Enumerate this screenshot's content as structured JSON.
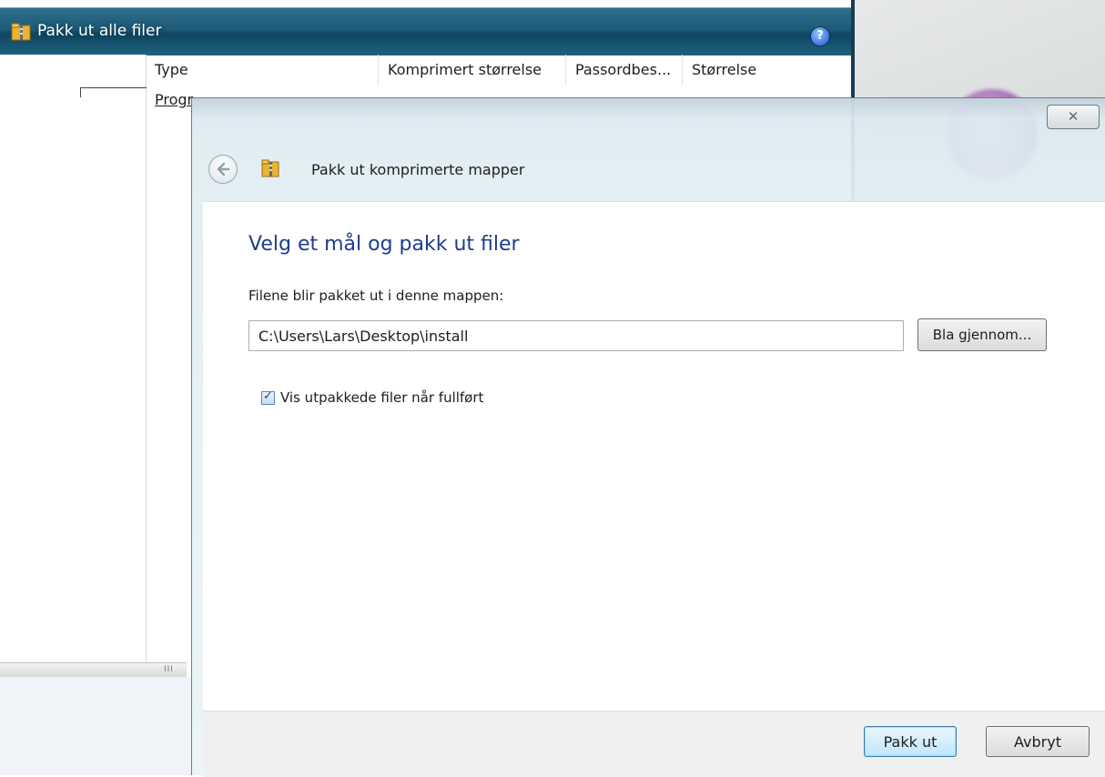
{
  "background_window": {
    "title": "Pakk ut alle filer",
    "help_icon": "help-icon",
    "columns": [
      "Type",
      "Komprimert størrelse",
      "Passordbes...",
      "Størrelse"
    ],
    "row_type_partial": "Progr",
    "scroll_grip": "III"
  },
  "dialog": {
    "close_glyph": "✕",
    "wizard_title": "Pakk ut komprimerte mapper",
    "heading": "Velg et mål og pakk ut filer",
    "folder_label": "Filene blir pakket ut i denne mappen:",
    "path_value": "C:\\Users\\Lars\\Desktop\\install",
    "browse_label": "Bla gjennom...",
    "show_files_label": "Vis utpakkede filer når fullført",
    "show_files_checked": true,
    "extract_label": "Pakk ut",
    "cancel_label": "Avbryt"
  },
  "colors": {
    "titlebar": "#1d5a76",
    "heading": "#1e3d8c",
    "default_button_border": "#3c7fb1"
  }
}
